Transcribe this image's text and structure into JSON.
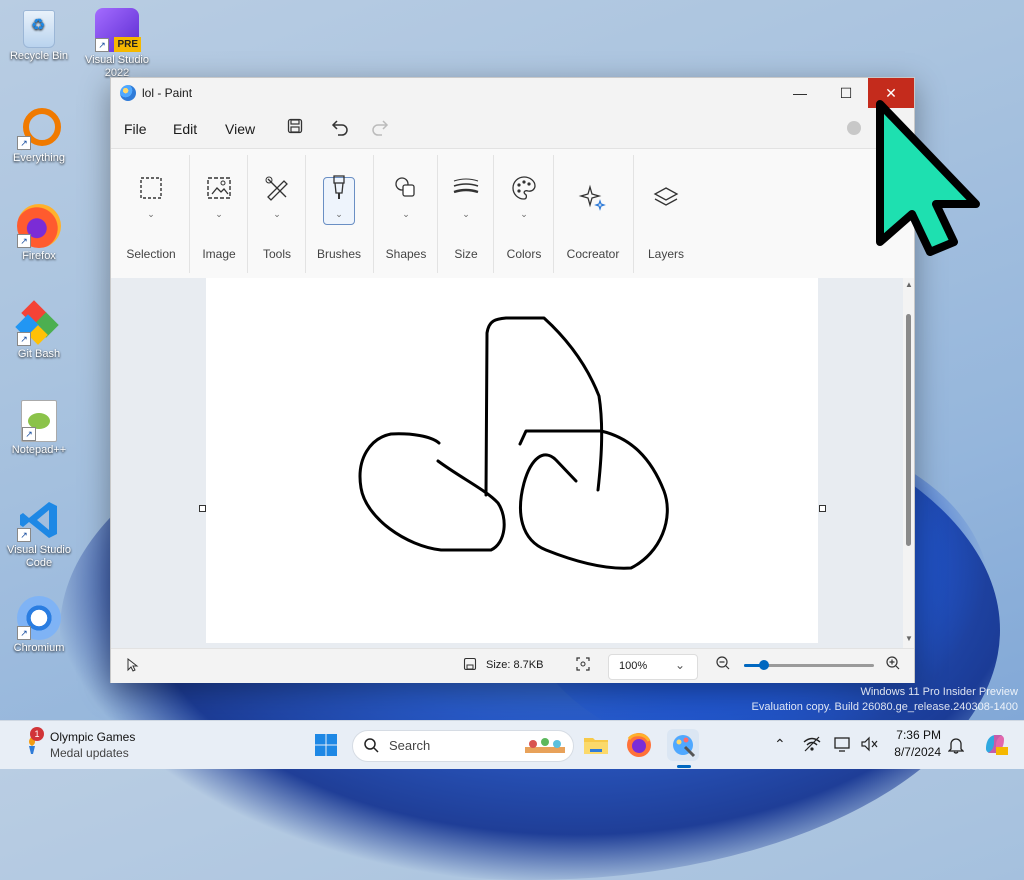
{
  "desktop": {
    "icons": [
      {
        "label": "Recycle Bin"
      },
      {
        "label": "Visual Studio 2022",
        "badge": "PRE"
      },
      {
        "label": "Everything"
      },
      {
        "label": "Firefox"
      },
      {
        "label": "Git Bash"
      },
      {
        "label": "Notepad++"
      },
      {
        "label": "Visual Studio Code"
      },
      {
        "label": "Chromium"
      }
    ]
  },
  "window": {
    "title": "lol - Paint",
    "controls": {
      "minimize": "—",
      "maximize": "☐",
      "close": "✕"
    }
  },
  "menu": {
    "file": "File",
    "edit": "Edit",
    "view": "View"
  },
  "ribbon": {
    "groups": [
      {
        "label": "Selection"
      },
      {
        "label": "Image"
      },
      {
        "label": "Tools"
      },
      {
        "label": "Brushes"
      },
      {
        "label": "Shapes"
      },
      {
        "label": "Size"
      },
      {
        "label": "Colors"
      },
      {
        "label": "Cocreator"
      },
      {
        "label": "Layers"
      }
    ]
  },
  "status": {
    "size": "Size: 8.7KB",
    "zoom": "100%"
  },
  "watermark": {
    "line1": "Windows 11 Pro Insider Preview",
    "line2": "Evaluation copy. Build 26080.ge_release.240308-1400"
  },
  "taskbar": {
    "widget_title": "Olympic Games",
    "widget_sub": "Medal updates",
    "widget_badge": "1",
    "search_placeholder": "Search",
    "time": "7:36 PM",
    "date": "8/7/2024"
  },
  "colors": {
    "accent": "#0067c0",
    "close": "#c42b1c",
    "cursor": "#1ee0b0"
  }
}
